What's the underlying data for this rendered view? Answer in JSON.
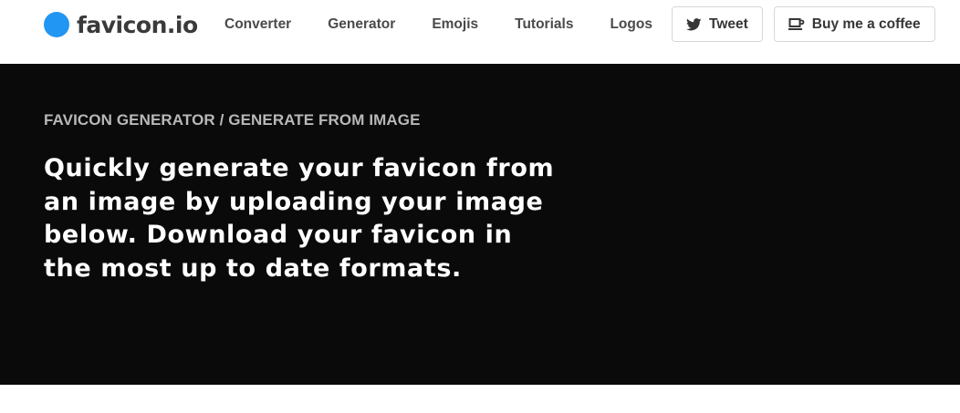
{
  "brand": {
    "name": "favicon.io",
    "color": "#2196f3"
  },
  "nav": {
    "links": [
      {
        "label": "Converter"
      },
      {
        "label": "Generator"
      },
      {
        "label": "Emojis"
      },
      {
        "label": "Tutorials"
      },
      {
        "label": "Logos"
      }
    ],
    "buttons": {
      "tweet": {
        "label": "Tweet",
        "icon": "twitter-icon"
      },
      "coffee": {
        "label": "Buy me a coffee",
        "icon": "coffee-cup-icon"
      }
    }
  },
  "hero": {
    "breadcrumb": "FAVICON GENERATOR / GENERATE FROM IMAGE",
    "title": "Quickly generate your favicon from an image by uploading your image below. Download your favicon in the most up to date formats.",
    "background": "#0a0a0a"
  }
}
